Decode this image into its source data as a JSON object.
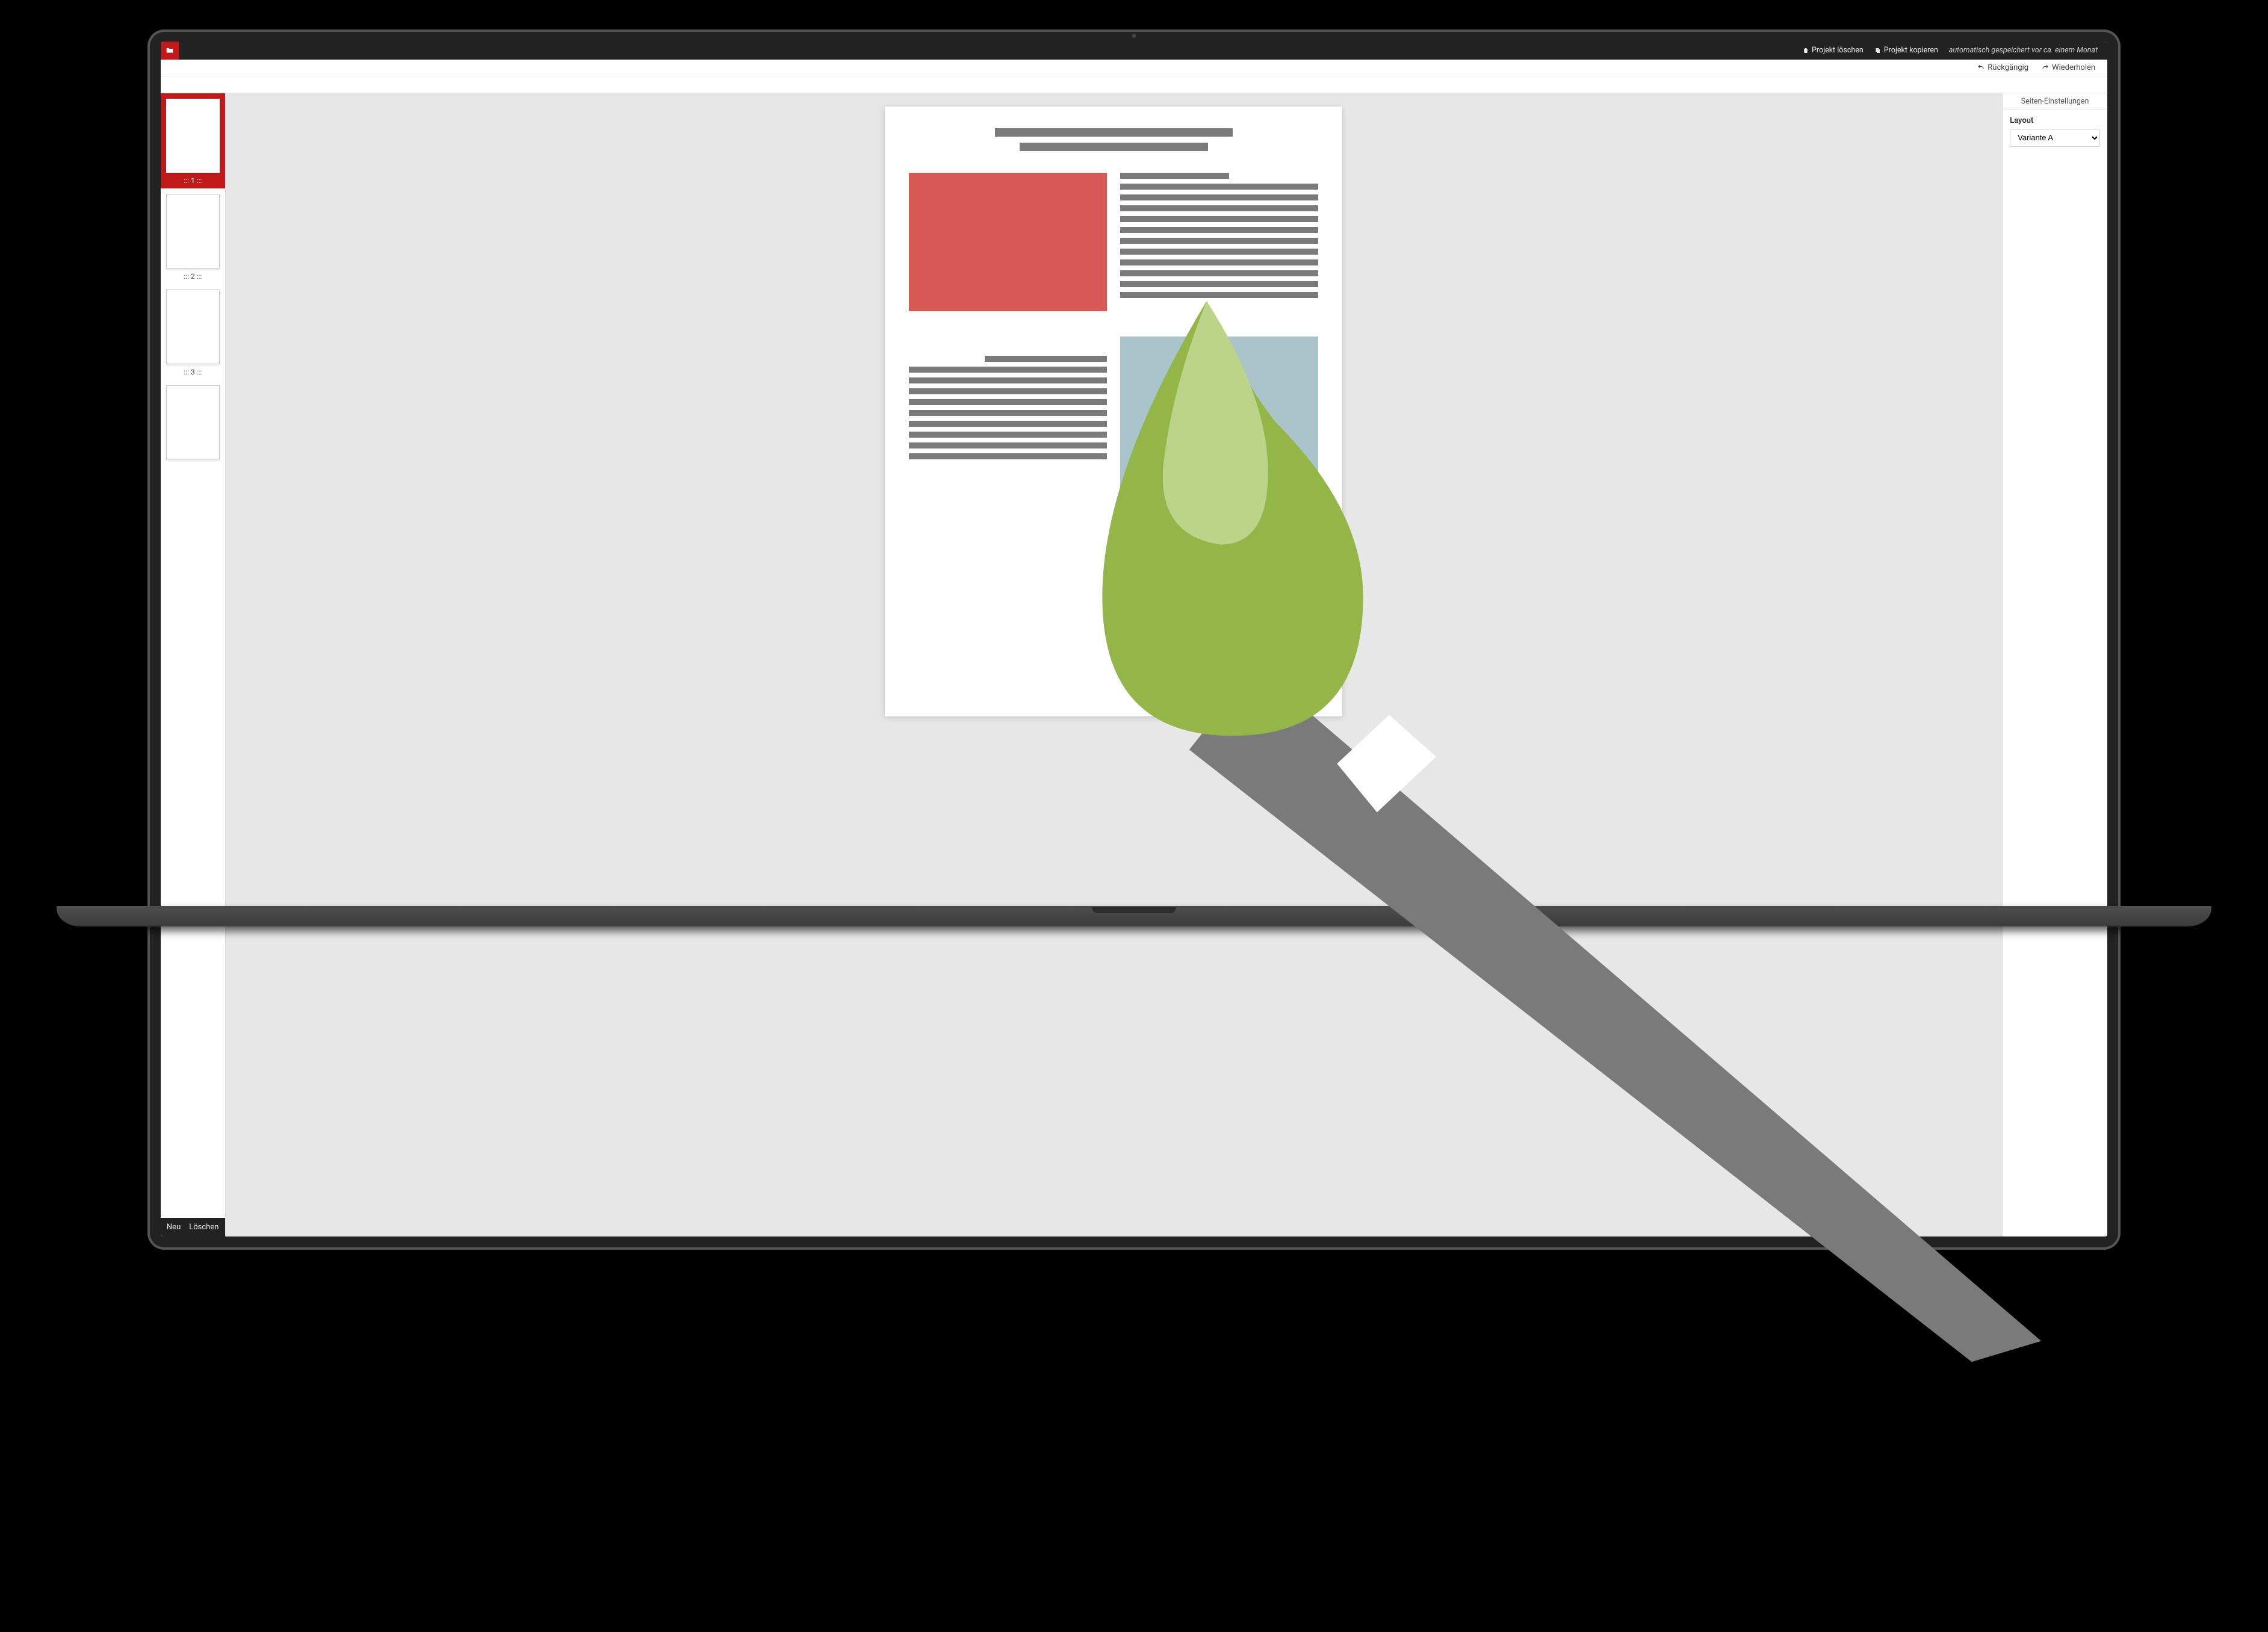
{
  "colors": {
    "accent": "#c21a1a",
    "placeholder_gray": "#7a7a7a",
    "placeholder_red": "#d85a56",
    "placeholder_blue": "#aac4cb",
    "drop_green": "#94b648",
    "drop_green_light": "#bcd48a"
  },
  "top_bar": {
    "delete_project": "Projekt löschen",
    "copy_project": "Projekt kopieren",
    "save_status": "automatisch gespeichert vor ca. einem Monat"
  },
  "ribbon": {
    "undo": "Rückgängig",
    "redo": "Wiederholen"
  },
  "sidebar": {
    "pages": [
      {
        "label": "::: 1 :::",
        "active": true
      },
      {
        "label": "::: 2 :::",
        "active": false
      },
      {
        "label": "::: 3 :::",
        "active": false
      },
      {
        "label": "",
        "active": false
      }
    ],
    "footer": {
      "new": "Neu",
      "delete": "Löschen"
    }
  },
  "settings": {
    "panel_title": "Seiten-Einstellungen",
    "layout_label": "Layout",
    "layout_value": "Variante A"
  }
}
